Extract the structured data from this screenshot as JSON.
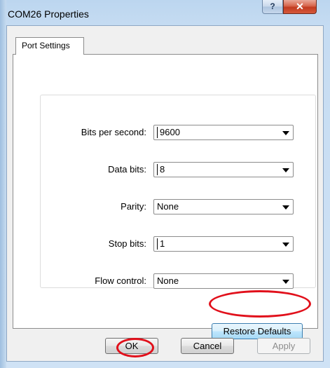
{
  "window": {
    "title": "COM26 Properties",
    "help_label": "?",
    "close_label": "✕"
  },
  "tabs": [
    {
      "label": "Port Settings",
      "selected": true
    }
  ],
  "settings": [
    {
      "label": "Bits per second:",
      "value": "9600"
    },
    {
      "label": "Data bits:",
      "value": "8"
    },
    {
      "label": "Parity:",
      "value": "None"
    },
    {
      "label": "Stop bits:",
      "value": "1"
    },
    {
      "label": "Flow control:",
      "value": "None"
    }
  ],
  "buttons": {
    "restore_defaults": "Restore Defaults",
    "ok": "OK",
    "cancel": "Cancel",
    "apply": "Apply"
  },
  "colors": {
    "highlight_circle": "#e1101b"
  }
}
